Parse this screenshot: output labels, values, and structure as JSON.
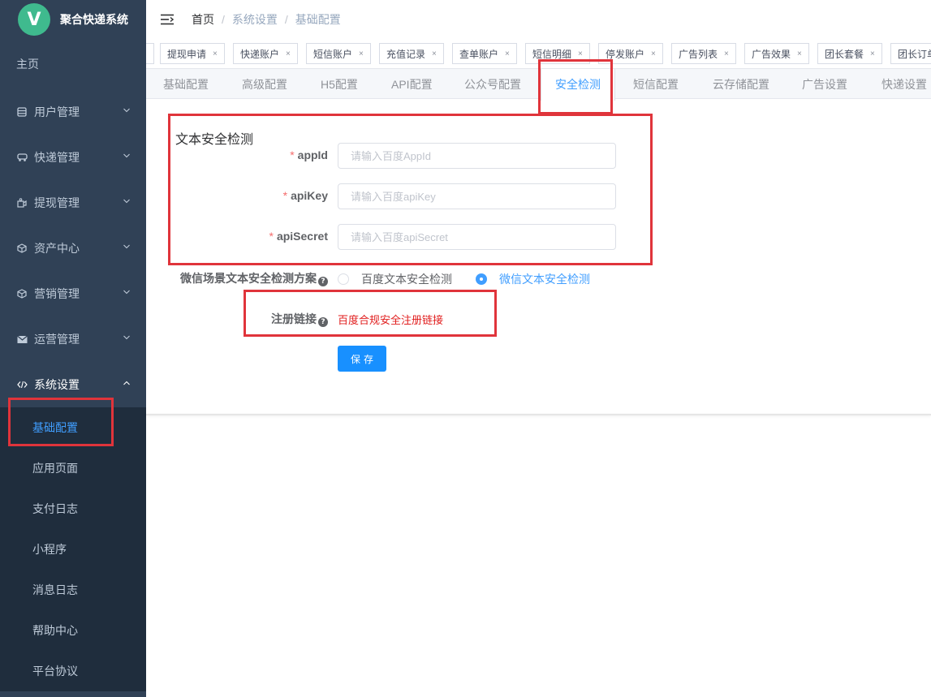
{
  "app": {
    "logo_letter": "V",
    "title": "聚合快递系统"
  },
  "sidebar": {
    "home": "主页",
    "menus": [
      {
        "label": "用户管理",
        "icon": "list-icon"
      },
      {
        "label": "快递管理",
        "icon": "car-icon"
      },
      {
        "label": "提现管理",
        "icon": "money-icon"
      },
      {
        "label": "资产中心",
        "icon": "box-icon"
      },
      {
        "label": "营销管理",
        "icon": "box-icon"
      },
      {
        "label": "运营管理",
        "icon": "mail-icon"
      }
    ],
    "system": {
      "label": "系统设置",
      "icon": "code-icon"
    },
    "sub_items": [
      "基础配置",
      "应用页面",
      "支付日志",
      "小程序",
      "消息日志",
      "帮助中心",
      "平台协议"
    ],
    "active_sub": "基础配置"
  },
  "breadcrumb": [
    "首页",
    "系统设置",
    "基础配置"
  ],
  "tags": [
    "提现申请",
    "快递账户",
    "短信账户",
    "充值记录",
    "查单账户",
    "短信明细",
    "停发账户",
    "广告列表",
    "广告效果",
    "团长套餐",
    "团长订单"
  ],
  "tag_close": "×",
  "config_tabs": [
    "基础配置",
    "高级配置",
    "H5配置",
    "API配置",
    "公众号配置",
    "安全检测",
    "短信配置",
    "云存储配置",
    "广告设置",
    "快递设置"
  ],
  "active_tab": "安全检测",
  "form": {
    "section_title": "文本安全检测",
    "required_mark": "*",
    "fields": [
      {
        "label": "appId",
        "placeholder": "请输入百度AppId",
        "value": ""
      },
      {
        "label": "apiKey",
        "placeholder": "请输入百度apiKey",
        "value": ""
      },
      {
        "label": "apiSecret",
        "placeholder": "请输入百度apiSecret",
        "value": ""
      }
    ],
    "scheme_label": "微信场景文本安全检测方案",
    "help_mark": "?",
    "scheme_options": [
      "百度文本安全检测",
      "微信文本安全检测"
    ],
    "scheme_selected": "微信文本安全检测",
    "register_label": "注册链接",
    "register_link": "百度合规安全注册链接",
    "save_label": "保存"
  },
  "colors": {
    "sidebar_bg": "#304156",
    "submenu_bg": "#1f2d3d",
    "accent": "#409eff",
    "button": "#1890ff",
    "annotation": "#e0343b",
    "link_red": "#e11d1d"
  }
}
